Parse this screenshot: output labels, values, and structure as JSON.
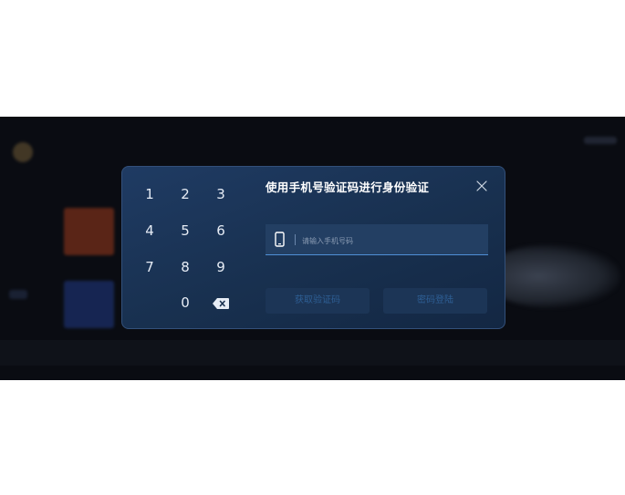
{
  "background": {
    "tiles": [
      "avatar",
      "app-tile-orange",
      "app-tile-blue",
      "status-text",
      "top-right-status"
    ],
    "accent": "#0a0c12"
  },
  "dialog": {
    "title": "使用手机号验证码进行身份验证",
    "close_icon": "close-icon",
    "keypad": {
      "keys": [
        "1",
        "2",
        "3",
        "4",
        "5",
        "6",
        "7",
        "8",
        "9",
        "0"
      ],
      "delete_icon": "backspace-icon"
    },
    "phone_field": {
      "icon": "phone-icon",
      "placeholder": "请输入手机号码",
      "value": ""
    },
    "buttons": {
      "get_code": "获取验证码",
      "password_login": "密码登陆"
    },
    "colors": {
      "panel": "#1a3352",
      "border": "#33507a",
      "underline": "#4f8fd6",
      "disabled_text": "#2e5f95"
    }
  }
}
